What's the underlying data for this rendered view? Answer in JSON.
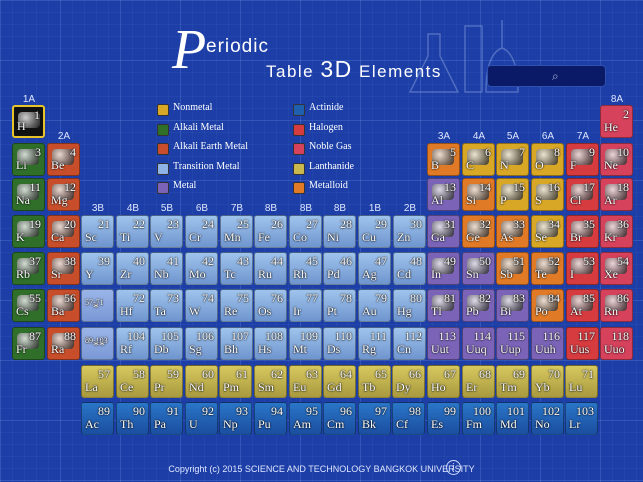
{
  "title": {
    "p": "P",
    "rest": "eriodic",
    "sub_1": "Table",
    "sub_2": "3D",
    "sub_3": "Elements"
  },
  "search": {
    "icon": "search-icon",
    "glyph": "⌕"
  },
  "groups": [
    "1A",
    "2A",
    "3B",
    "4B",
    "5B",
    "6B",
    "7B",
    "8B",
    "8B",
    "8B",
    "1B",
    "2B",
    "3A",
    "4A",
    "5A",
    "6A",
    "7A",
    "8A"
  ],
  "legend": [
    {
      "label": "Nonmetal",
      "color": "#d9a726"
    },
    {
      "label": "Alkali Metal",
      "color": "#2f6f2a"
    },
    {
      "label": "Alkali Earth Metal",
      "color": "#c84e2b"
    },
    {
      "label": "Transition Metal",
      "color": "#8fb3e6"
    },
    {
      "label": "Metal",
      "color": "#7b64b8"
    },
    {
      "label": "Actinide",
      "color": "#1e5fb0"
    },
    {
      "label": "Halogen",
      "color": "#d63b3f"
    },
    {
      "label": "Noble Gas",
      "color": "#d6425c"
    },
    {
      "label": "Lanthanide",
      "color": "#c9b84e"
    },
    {
      "label": "Metalloid",
      "color": "#e07a26"
    }
  ],
  "elements": [
    {
      "n": "1",
      "s": "H",
      "c": "nonmetal"
    },
    {
      "n": "2",
      "s": "He",
      "c": "noble"
    },
    {
      "n": "3",
      "s": "Li",
      "c": "alkali"
    },
    {
      "n": "4",
      "s": "Be",
      "c": "alkaline"
    },
    {
      "n": "5",
      "s": "B",
      "c": "metalloid"
    },
    {
      "n": "6",
      "s": "C",
      "c": "nonmetal"
    },
    {
      "n": "7",
      "s": "N",
      "c": "nonmetal"
    },
    {
      "n": "8",
      "s": "O",
      "c": "nonmetal"
    },
    {
      "n": "9",
      "s": "F",
      "c": "halogen"
    },
    {
      "n": "10",
      "s": "Ne",
      "c": "noble"
    },
    {
      "n": "11",
      "s": "Na",
      "c": "alkali"
    },
    {
      "n": "12",
      "s": "Mg",
      "c": "alkaline"
    },
    {
      "n": "13",
      "s": "Al",
      "c": "metal"
    },
    {
      "n": "14",
      "s": "Si",
      "c": "metalloid"
    },
    {
      "n": "15",
      "s": "P",
      "c": "nonmetal"
    },
    {
      "n": "16",
      "s": "S",
      "c": "nonmetal"
    },
    {
      "n": "17",
      "s": "Cl",
      "c": "halogen"
    },
    {
      "n": "18",
      "s": "Ar",
      "c": "noble"
    },
    {
      "n": "19",
      "s": "K",
      "c": "alkali"
    },
    {
      "n": "20",
      "s": "Ca",
      "c": "alkaline"
    },
    {
      "n": "21",
      "s": "Sc",
      "c": "transition"
    },
    {
      "n": "22",
      "s": "Ti",
      "c": "transition"
    },
    {
      "n": "23",
      "s": "V",
      "c": "transition"
    },
    {
      "n": "24",
      "s": "Cr",
      "c": "transition"
    },
    {
      "n": "25",
      "s": "Mn",
      "c": "transition"
    },
    {
      "n": "26",
      "s": "Fe",
      "c": "transition"
    },
    {
      "n": "27",
      "s": "Co",
      "c": "transition"
    },
    {
      "n": "28",
      "s": "Ni",
      "c": "transition"
    },
    {
      "n": "29",
      "s": "Cu",
      "c": "transition"
    },
    {
      "n": "30",
      "s": "Zn",
      "c": "transition"
    },
    {
      "n": "31",
      "s": "Ga",
      "c": "metal"
    },
    {
      "n": "32",
      "s": "Ge",
      "c": "metalloid"
    },
    {
      "n": "33",
      "s": "As",
      "c": "metalloid"
    },
    {
      "n": "34",
      "s": "Se",
      "c": "nonmetal"
    },
    {
      "n": "35",
      "s": "Br",
      "c": "halogen"
    },
    {
      "n": "36",
      "s": "Kr",
      "c": "noble"
    },
    {
      "n": "37",
      "s": "Rb",
      "c": "alkali"
    },
    {
      "n": "38",
      "s": "Sr",
      "c": "alkaline"
    },
    {
      "n": "39",
      "s": "Y",
      "c": "transition"
    },
    {
      "n": "40",
      "s": "Zr",
      "c": "transition"
    },
    {
      "n": "41",
      "s": "Nb",
      "c": "transition"
    },
    {
      "n": "42",
      "s": "Mo",
      "c": "transition"
    },
    {
      "n": "43",
      "s": "Tc",
      "c": "transition"
    },
    {
      "n": "44",
      "s": "Ru",
      "c": "transition"
    },
    {
      "n": "45",
      "s": "Rh",
      "c": "transition"
    },
    {
      "n": "46",
      "s": "Pd",
      "c": "transition"
    },
    {
      "n": "47",
      "s": "Ag",
      "c": "transition"
    },
    {
      "n": "48",
      "s": "Cd",
      "c": "transition"
    },
    {
      "n": "49",
      "s": "In",
      "c": "metal"
    },
    {
      "n": "50",
      "s": "Sn",
      "c": "metal"
    },
    {
      "n": "51",
      "s": "Sb",
      "c": "metalloid"
    },
    {
      "n": "52",
      "s": "Te",
      "c": "metalloid"
    },
    {
      "n": "53",
      "s": "I",
      "c": "halogen"
    },
    {
      "n": "54",
      "s": "Xe",
      "c": "noble"
    },
    {
      "n": "55",
      "s": "Cs",
      "c": "alkali"
    },
    {
      "n": "56",
      "s": "Ba",
      "c": "alkaline"
    },
    {
      "n": "57-71",
      "s": "*",
      "c": "range"
    },
    {
      "n": "72",
      "s": "Hf",
      "c": "transition"
    },
    {
      "n": "73",
      "s": "Ta",
      "c": "transition"
    },
    {
      "n": "74",
      "s": "W",
      "c": "transition"
    },
    {
      "n": "75",
      "s": "Re",
      "c": "transition"
    },
    {
      "n": "76",
      "s": "Os",
      "c": "transition"
    },
    {
      "n": "77",
      "s": "Ir",
      "c": "transition"
    },
    {
      "n": "78",
      "s": "Pt",
      "c": "transition"
    },
    {
      "n": "79",
      "s": "Au",
      "c": "transition"
    },
    {
      "n": "80",
      "s": "Hg",
      "c": "transition"
    },
    {
      "n": "81",
      "s": "Tl",
      "c": "metal"
    },
    {
      "n": "82",
      "s": "Pb",
      "c": "metal"
    },
    {
      "n": "83",
      "s": "Bi",
      "c": "metal"
    },
    {
      "n": "84",
      "s": "Po",
      "c": "metalloid"
    },
    {
      "n": "85",
      "s": "At",
      "c": "halogen"
    },
    {
      "n": "86",
      "s": "Rn",
      "c": "noble"
    },
    {
      "n": "87",
      "s": "Fr",
      "c": "alkali"
    },
    {
      "n": "88",
      "s": "Ra",
      "c": "alkaline"
    },
    {
      "n": "89-103",
      "s": "**",
      "c": "range"
    },
    {
      "n": "104",
      "s": "Rf",
      "c": "transition"
    },
    {
      "n": "105",
      "s": "Db",
      "c": "transition"
    },
    {
      "n": "106",
      "s": "Sg",
      "c": "transition"
    },
    {
      "n": "107",
      "s": "Bh",
      "c": "transition"
    },
    {
      "n": "108",
      "s": "Hs",
      "c": "transition"
    },
    {
      "n": "109",
      "s": "Mt",
      "c": "transition"
    },
    {
      "n": "110",
      "s": "Ds",
      "c": "transition"
    },
    {
      "n": "111",
      "s": "Rg",
      "c": "transition"
    },
    {
      "n": "112",
      "s": "Cn",
      "c": "transition"
    },
    {
      "n": "113",
      "s": "Uut",
      "c": "metal"
    },
    {
      "n": "114",
      "s": "Uuq",
      "c": "metal"
    },
    {
      "n": "115",
      "s": "Uup",
      "c": "metal"
    },
    {
      "n": "116",
      "s": "Uuh",
      "c": "metal"
    },
    {
      "n": "117",
      "s": "Uus",
      "c": "halogen"
    },
    {
      "n": "118",
      "s": "Uuo",
      "c": "noble"
    }
  ],
  "lanthanides": [
    {
      "n": "57",
      "s": "La"
    },
    {
      "n": "58",
      "s": "Ce"
    },
    {
      "n": "59",
      "s": "Pr"
    },
    {
      "n": "60",
      "s": "Nd"
    },
    {
      "n": "61",
      "s": "Pm"
    },
    {
      "n": "62",
      "s": "Sm"
    },
    {
      "n": "63",
      "s": "Eu"
    },
    {
      "n": "64",
      "s": "Gd"
    },
    {
      "n": "65",
      "s": "Tb"
    },
    {
      "n": "66",
      "s": "Dy"
    },
    {
      "n": "67",
      "s": "Ho"
    },
    {
      "n": "68",
      "s": "Er"
    },
    {
      "n": "69",
      "s": "Tm"
    },
    {
      "n": "70",
      "s": "Yb"
    },
    {
      "n": "71",
      "s": "Lu"
    }
  ],
  "actinides": [
    {
      "n": "89",
      "s": "Ac"
    },
    {
      "n": "90",
      "s": "Th"
    },
    {
      "n": "91",
      "s": "Pa"
    },
    {
      "n": "92",
      "s": "U"
    },
    {
      "n": "93",
      "s": "Np"
    },
    {
      "n": "94",
      "s": "Pu"
    },
    {
      "n": "95",
      "s": "Am"
    },
    {
      "n": "96",
      "s": "Cm"
    },
    {
      "n": "97",
      "s": "Bk"
    },
    {
      "n": "98",
      "s": "Cf"
    },
    {
      "n": "99",
      "s": "Es"
    },
    {
      "n": "100",
      "s": "Fm"
    },
    {
      "n": "101",
      "s": "Md"
    },
    {
      "n": "102",
      "s": "No"
    },
    {
      "n": "103",
      "s": "Lr"
    }
  ],
  "footer": {
    "copyright": "Copyright (c) 2015 SCIENCE AND TECHNOLOGY  BANGKOK  UNIVERSITY",
    "info": "i"
  }
}
